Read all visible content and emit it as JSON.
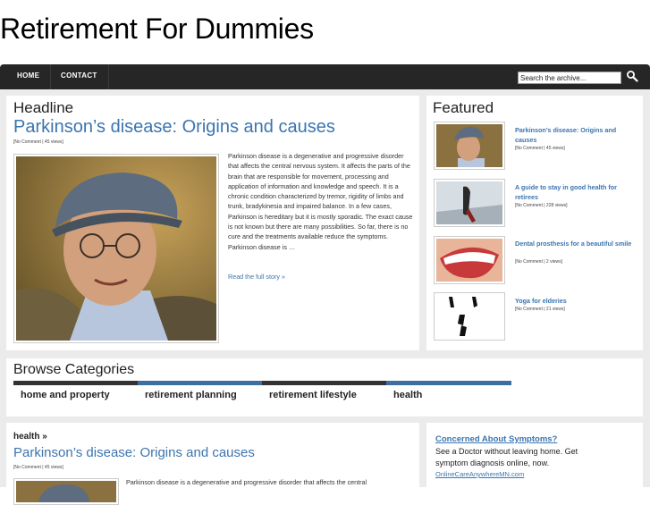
{
  "site": {
    "title": "Retirement For Dummies"
  },
  "nav": {
    "items": [
      "HOME",
      "CONTACT"
    ],
    "search": {
      "value": "Search the archive..."
    }
  },
  "headline": {
    "label": "Headline",
    "title": "Parkinson’s disease: Origins and causes",
    "meta": "[No Comment | 45 views]",
    "excerpt": "Parkinson disease is a degenerative and progressive disorder that affects the central nervous system. It affects the parts of the brain that are responsible for movement, processing and application of information and knowledge and speech. It is a chronic condition characterized by tremor, rigidity of limbs and trunk, bradykinesia and impaired balance. In a few cases, Parkinson is hereditary but it is mostly sporadic. The exact cause is not known but there are many possibilities. So far, there is no cure and the treatments available reduce the symptoms. Parkinson disease is …",
    "read_more": "Read the full story »",
    "image_icon": "elderly-man-photo"
  },
  "featured": {
    "label": "Featured",
    "items": [
      {
        "title": "Parkinson’s disease: Origins and causes",
        "meta": "[No Comment | 45 views]",
        "icon": "elderly-man-photo"
      },
      {
        "title": "A guide to stay in good health for retirees",
        "meta": "[No Comment | 228 views]",
        "icon": "runner-photo"
      },
      {
        "title": "Dental prosthesis for a beautiful smile",
        "meta": "[No Comment | 2 views]",
        "icon": "smile-photo"
      },
      {
        "title": "Yoga for elderies",
        "meta": "[No Comment | 21 views]",
        "icon": "yoga-photo"
      }
    ]
  },
  "categories": {
    "label": "Browse Categories",
    "items": [
      "home and property",
      "retirement planning",
      "retirement lifestyle",
      "health"
    ],
    "colors": [
      "#333333",
      "#3d6e9e",
      "#333333",
      "#3d6e9e"
    ]
  },
  "bottom": {
    "category": "health »",
    "title": "Parkinson’s disease: Origins and causes",
    "meta": "[No Comment | 45 views]",
    "excerpt": "Parkinson disease is a degenerative and progressive disorder that affects the central"
  },
  "ad": {
    "title": "Concerned About Symptoms?",
    "body": "See a Doctor without leaving home. Get symptom diagnosis online, now.",
    "url": "OnlineCareAnywhereMN.com"
  },
  "colors": {
    "link": "#3b75b0",
    "nav_bg": "#262626",
    "content_bg": "#ebebeb"
  }
}
